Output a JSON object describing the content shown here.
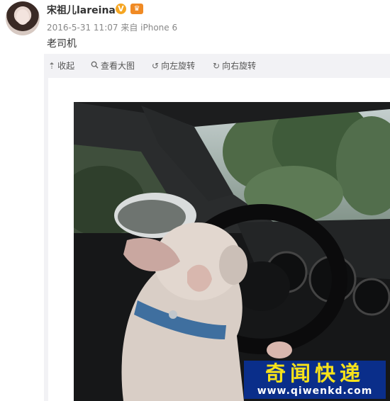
{
  "user": {
    "name": "宋祖儿lareina",
    "verified_badge": "V",
    "timestamp": "2016-5-31 11:07",
    "source": "来自 iPhone 6"
  },
  "post": {
    "text": "老司机"
  },
  "toolbar": {
    "collapse_label": "收起",
    "view_large_label": "查看大图",
    "rotate_left_label": "向左旋转",
    "rotate_right_label": "向右旋转"
  },
  "watermark": {
    "title": "奇闻快递",
    "url": "www.qiwenkd.com"
  },
  "colors": {
    "watermark_bg": "#0a2e8a",
    "watermark_title": "#f7e21a",
    "verified_badge": "#f5a623"
  },
  "icons": {
    "collapse": "arrow-up-icon",
    "view_large": "magnifier-icon",
    "rotate_left": "rotate-left-icon",
    "rotate_right": "rotate-right-icon"
  }
}
